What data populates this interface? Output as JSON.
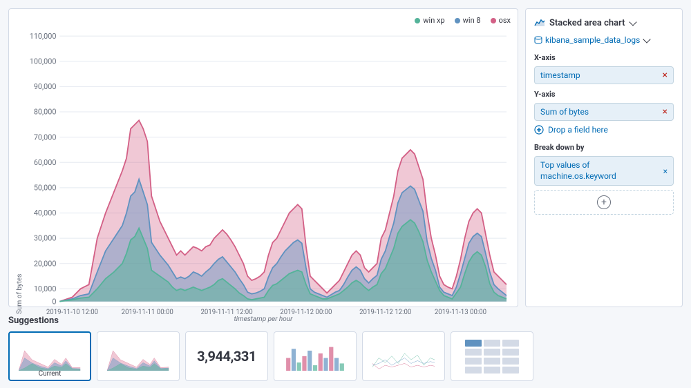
{
  "chart": {
    "title": "Stacked area chart",
    "datasource": "kibana_sample_data_logs",
    "yAxisLabel": "Sum of bytes",
    "xAxisLabel": "timestamp per hour",
    "legend": [
      {
        "label": "win xp",
        "color": "#54b399"
      },
      {
        "label": "win 8",
        "color": "#6092c0"
      },
      {
        "label": "osx",
        "color": "#d36086"
      }
    ],
    "yTicks": [
      "110,000",
      "100,000",
      "90,000",
      "80,000",
      "70,000",
      "60,000",
      "50,000",
      "40,000",
      "30,000",
      "20,000",
      "10,000",
      "0"
    ],
    "xTicks": [
      "2019-11-10 12:00",
      "2019-11-11 00:00",
      "2019-11-11 12:00",
      "2019-11-12 00:00",
      "2019-11-12 12:00",
      "2019-11-13 00:00"
    ]
  },
  "rightPanel": {
    "title": "Stacked area chart",
    "datasourceLabel": "kibana_sample_data_logs",
    "xAxisLabel": "X-axis",
    "xAxisField": "timestamp",
    "yAxisLabel": "Y-axis",
    "yAxisField": "Sum of bytes",
    "dropFieldLabel": "Drop a field here",
    "breakdownLabel": "Break down by",
    "breakdownField": "Top values of\nmachine.os.keyword",
    "removeLabel": "×"
  },
  "suggestions": {
    "title": "Suggestions",
    "cards": [
      {
        "label": "Current",
        "type": "chart-current",
        "active": true
      },
      {
        "label": "",
        "type": "chart-variant1",
        "active": false
      },
      {
        "label": "",
        "type": "number",
        "value": "3,944,331",
        "active": false
      },
      {
        "label": "",
        "type": "chart-variant2",
        "active": false
      },
      {
        "label": "",
        "type": "chart-variant3",
        "active": false
      },
      {
        "label": "",
        "type": "grid",
        "active": false
      }
    ]
  }
}
